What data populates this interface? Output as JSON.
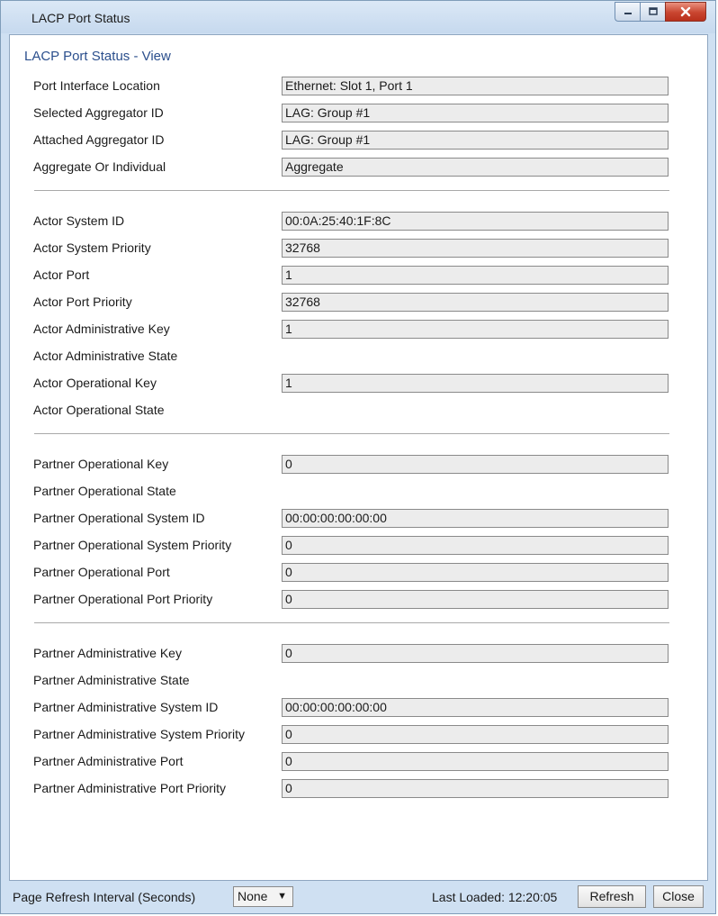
{
  "window": {
    "title": "LACP Port Status",
    "minimize_icon": "minimize-icon",
    "maximize_icon": "maximize-icon",
    "close_icon": "close-icon"
  },
  "view_title": "LACP Port Status - View",
  "sections": [
    {
      "rows": [
        {
          "label": "Port Interface Location",
          "value": "Ethernet: Slot 1, Port 1",
          "has_field": true
        },
        {
          "label": "Selected Aggregator ID",
          "value": "LAG: Group #1",
          "has_field": true
        },
        {
          "label": "Attached Aggregator ID",
          "value": "LAG: Group #1",
          "has_field": true
        },
        {
          "label": "Aggregate Or Individual",
          "value": "Aggregate",
          "has_field": true
        }
      ]
    },
    {
      "rows": [
        {
          "label": "Actor System ID",
          "value": "00:0A:25:40:1F:8C",
          "has_field": true
        },
        {
          "label": "Actor System Priority",
          "value": "32768",
          "has_field": true
        },
        {
          "label": "Actor Port",
          "value": "1",
          "has_field": true
        },
        {
          "label": "Actor Port Priority",
          "value": "32768",
          "has_field": true
        },
        {
          "label": "Actor Administrative Key",
          "value": "1",
          "has_field": true
        },
        {
          "label": "Actor Administrative State",
          "value": "",
          "has_field": false
        },
        {
          "label": "Actor Operational Key",
          "value": "1",
          "has_field": true
        },
        {
          "label": "Actor Operational State",
          "value": "",
          "has_field": false
        }
      ]
    },
    {
      "rows": [
        {
          "label": "Partner Operational Key",
          "value": "0",
          "has_field": true
        },
        {
          "label": "Partner Operational State",
          "value": "",
          "has_field": false
        },
        {
          "label": "Partner Operational System ID",
          "value": "00:00:00:00:00:00",
          "has_field": true
        },
        {
          "label": "Partner Operational System Priority",
          "value": "0",
          "has_field": true
        },
        {
          "label": "Partner Operational Port",
          "value": "0",
          "has_field": true
        },
        {
          "label": "Partner Operational Port Priority",
          "value": "0",
          "has_field": true
        }
      ]
    },
    {
      "rows": [
        {
          "label": "Partner Administrative Key",
          "value": "0",
          "has_field": true
        },
        {
          "label": "Partner Administrative State",
          "value": "",
          "has_field": false
        },
        {
          "label": "Partner Administrative System ID",
          "value": "00:00:00:00:00:00",
          "has_field": true
        },
        {
          "label": "Partner Administrative System Priority",
          "value": "0",
          "has_field": true
        },
        {
          "label": "Partner Administrative Port",
          "value": "0",
          "has_field": true
        },
        {
          "label": "Partner Administrative Port Priority",
          "value": "0",
          "has_field": true
        }
      ]
    }
  ],
  "footer": {
    "refresh_interval_label": "Page Refresh Interval (Seconds)",
    "refresh_interval_value": "None",
    "last_loaded": "Last Loaded: 12:20:05",
    "refresh_button": "Refresh",
    "close_button": "Close"
  }
}
